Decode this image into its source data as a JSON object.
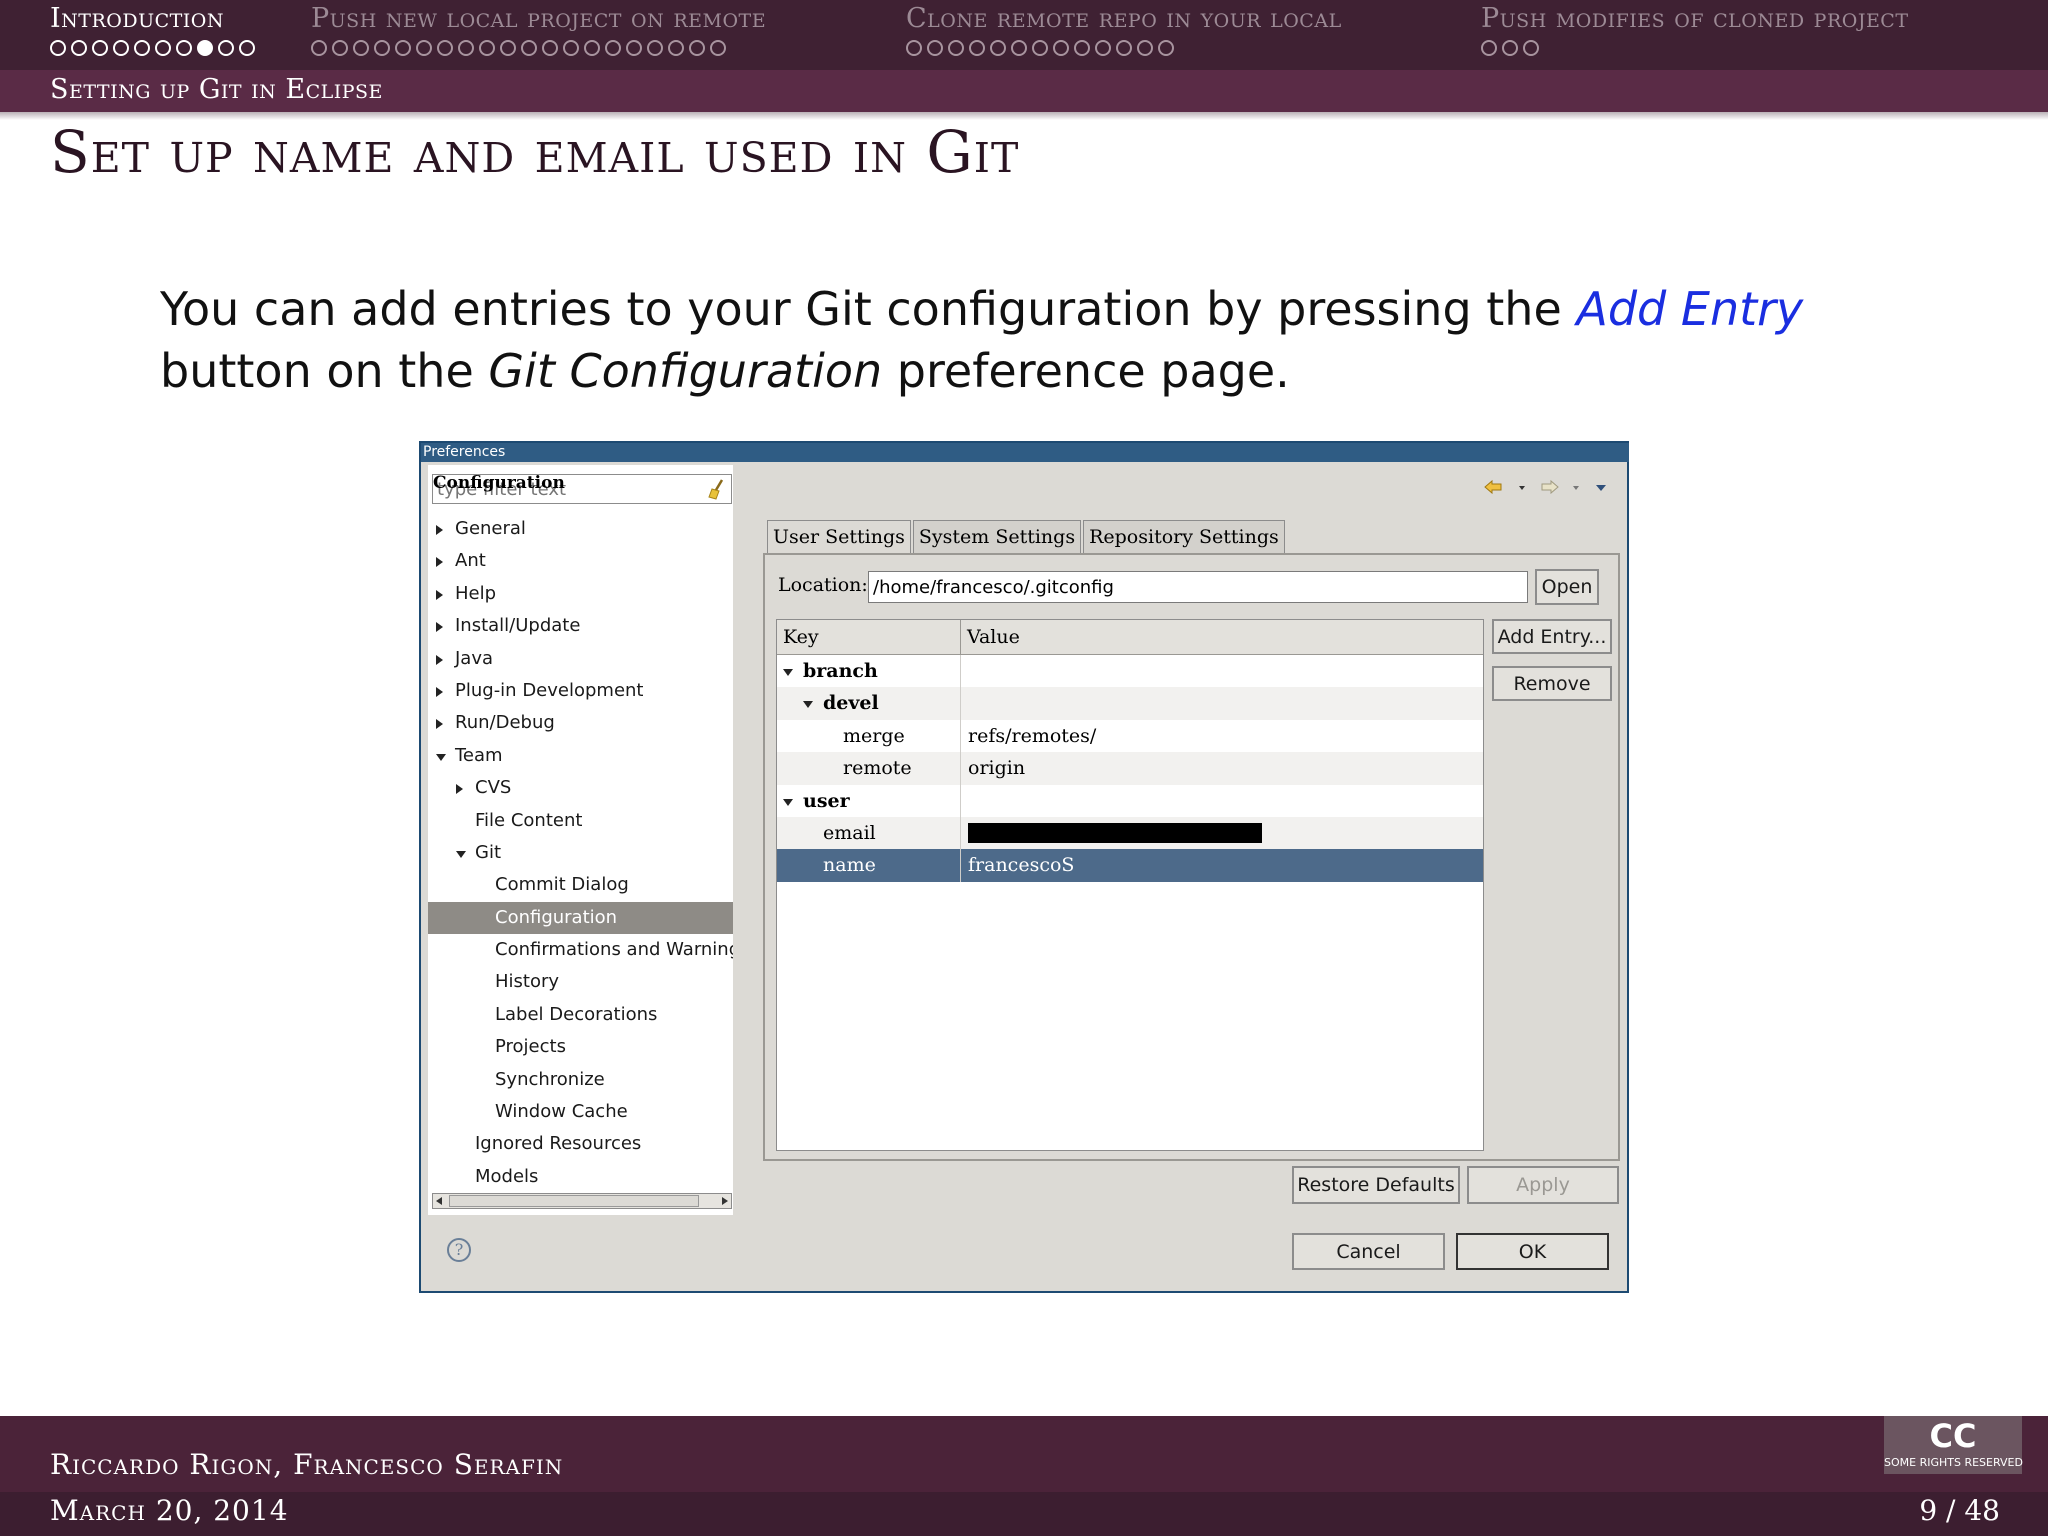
{
  "header": {
    "sections": [
      {
        "title": "Introduction",
        "dots": 10,
        "filled_index": 7,
        "active": true
      },
      {
        "title": "Push new local project on remote",
        "dots": 20,
        "filled_index": -1,
        "active": false
      },
      {
        "title": "Clone remote repo in your local",
        "dots": 13,
        "filled_index": -1,
        "active": false
      },
      {
        "title": "Push modifies of cloned project",
        "dots": 3,
        "filled_index": -1,
        "active": false
      }
    ],
    "subsection": "Setting up Git in Eclipse"
  },
  "frame_title": "Set up name and email used in Git",
  "body": {
    "part1": "You can add entries to your Git configuration by pressing the ",
    "add_entry": "Add Entry",
    "part2": " button on the ",
    "git_configuration": "Git Configuration",
    "part3": " preference page."
  },
  "window": {
    "title": "Preferences",
    "filter_placeholder": "type filter text",
    "tree": [
      {
        "label": "General",
        "indent": 0,
        "arrow": "right"
      },
      {
        "label": "Ant",
        "indent": 0,
        "arrow": "right"
      },
      {
        "label": "Help",
        "indent": 0,
        "arrow": "right"
      },
      {
        "label": "Install/Update",
        "indent": 0,
        "arrow": "right"
      },
      {
        "label": "Java",
        "indent": 0,
        "arrow": "right"
      },
      {
        "label": "Plug-in Development",
        "indent": 0,
        "arrow": "right"
      },
      {
        "label": "Run/Debug",
        "indent": 0,
        "arrow": "right"
      },
      {
        "label": "Team",
        "indent": 0,
        "arrow": "down"
      },
      {
        "label": "CVS",
        "indent": 1,
        "arrow": "right"
      },
      {
        "label": "File Content",
        "indent": 1,
        "arrow": "none"
      },
      {
        "label": "Git",
        "indent": 1,
        "arrow": "down"
      },
      {
        "label": "Commit Dialog",
        "indent": 2,
        "arrow": "none"
      },
      {
        "label": "Configuration",
        "indent": 2,
        "arrow": "none",
        "selected": true
      },
      {
        "label": "Confirmations and Warnings",
        "indent": 2,
        "arrow": "none"
      },
      {
        "label": "History",
        "indent": 2,
        "arrow": "none"
      },
      {
        "label": "Label Decorations",
        "indent": 2,
        "arrow": "none"
      },
      {
        "label": "Projects",
        "indent": 2,
        "arrow": "none"
      },
      {
        "label": "Synchronize",
        "indent": 2,
        "arrow": "none"
      },
      {
        "label": "Window Cache",
        "indent": 2,
        "arrow": "none"
      },
      {
        "label": "Ignored Resources",
        "indent": 1,
        "arrow": "none"
      },
      {
        "label": "Models",
        "indent": 1,
        "arrow": "none"
      }
    ],
    "config_title": "Configuration",
    "tabs": [
      "User Settings",
      "System Settings",
      "Repository Settings"
    ],
    "location_label": "Location:",
    "location_value": "/home/francesco/.gitconfig",
    "open_button": "Open",
    "table_headers": {
      "key": "Key",
      "value": "Value"
    },
    "rows": [
      {
        "key": "branch",
        "value": "",
        "level": 0,
        "arrow": "down",
        "bold": true
      },
      {
        "key": "devel",
        "value": "",
        "level": 1,
        "arrow": "down",
        "bold": true
      },
      {
        "key": "merge",
        "value": "refs/remotes/",
        "level": 2,
        "arrow": "none"
      },
      {
        "key": "remote",
        "value": "origin",
        "level": 2,
        "arrow": "none"
      },
      {
        "key": "user",
        "value": "",
        "level": 0,
        "arrow": "down",
        "bold": true
      },
      {
        "key": "email",
        "value": "",
        "level": 1,
        "arrow": "none",
        "redacted": true
      },
      {
        "key": "name",
        "value": "francescoS",
        "level": 1,
        "arrow": "none",
        "selected": true
      }
    ],
    "add_entry_button": "Add Entry...",
    "remove_button": "Remove",
    "restore_defaults_button": "Restore Defaults",
    "apply_button": "Apply",
    "cancel_button": "Cancel",
    "ok_button": "OK",
    "help_icon": "question-mark-icon"
  },
  "footer": {
    "authors": "Riccardo Rigon, Francesco Serafin",
    "date": "March 20, 2014",
    "page": "9 / 48",
    "cc_letters": "CC",
    "cc_caption": "SOME RIGHTS RESERVED"
  }
}
